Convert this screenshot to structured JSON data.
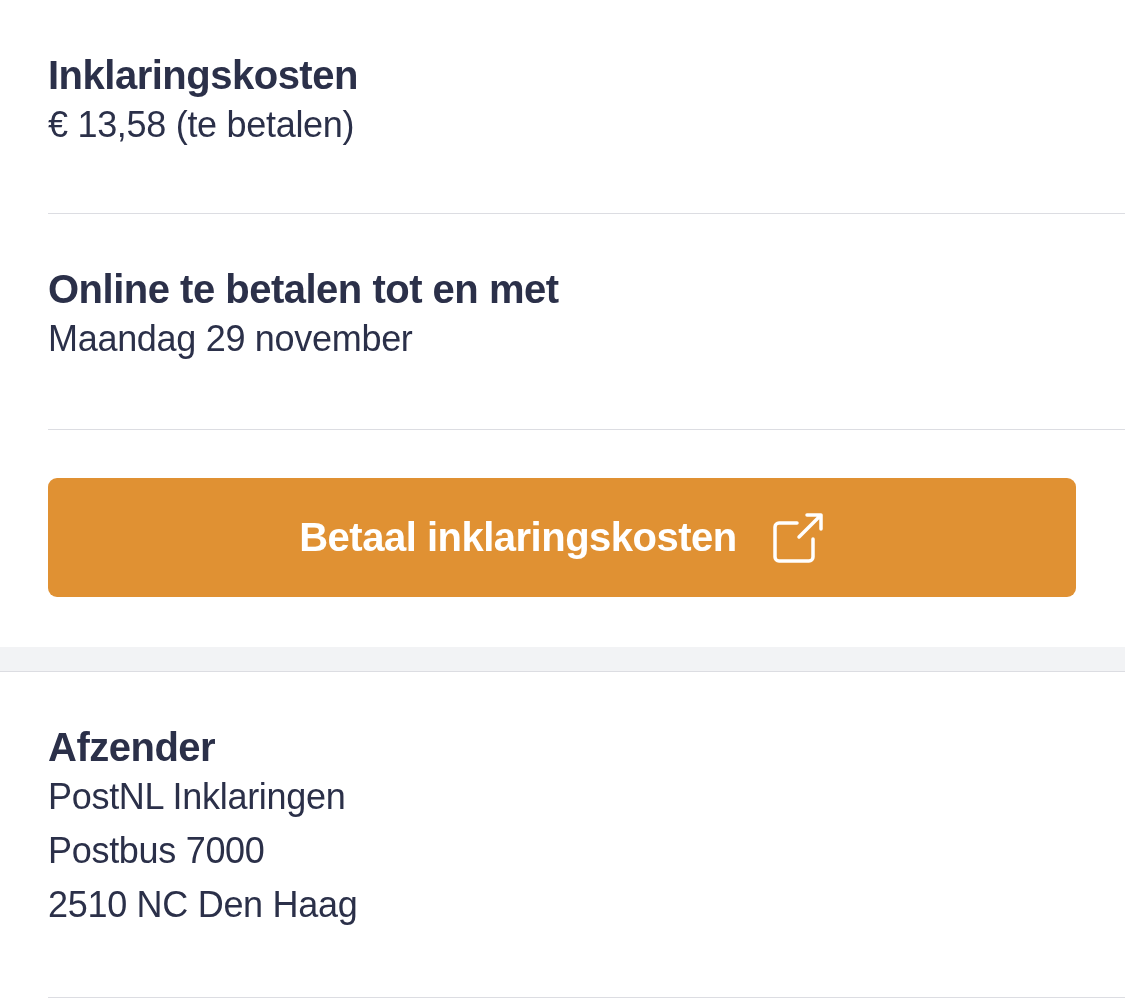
{
  "sections": [
    {
      "title": "Inklaringskosten",
      "lines": [
        "€ 13,58 (te betalen)"
      ]
    },
    {
      "title": "Online te betalen tot en met",
      "lines": [
        "Maandag 29 november"
      ]
    }
  ],
  "button": {
    "label": "Betaal inklaringskosten"
  },
  "sender": {
    "title": "Afzender",
    "lines": [
      "PostNL Inklaringen",
      "Postbus 7000",
      "2510 NC Den Haag"
    ]
  }
}
